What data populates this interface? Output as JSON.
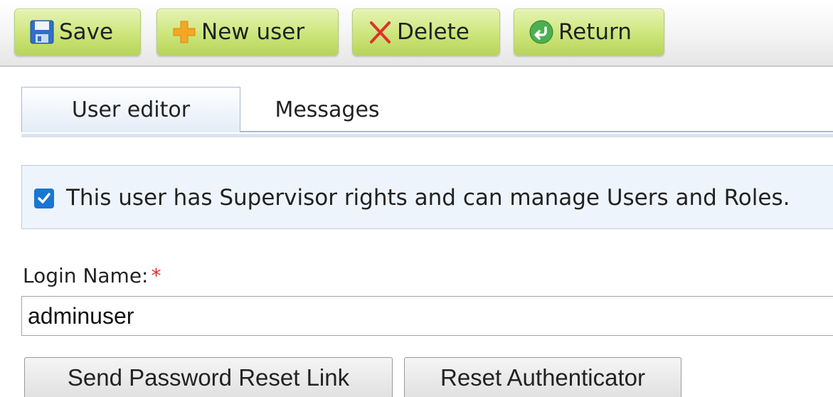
{
  "toolbar": {
    "save_label": "Save",
    "new_user_label": "New user",
    "delete_label": "Delete",
    "return_label": "Return",
    "icons": [
      "save-icon",
      "plus-icon",
      "delete-x-icon",
      "return-arrow-icon"
    ]
  },
  "tabs": [
    {
      "label": "User editor",
      "active": true
    },
    {
      "label": "Messages",
      "active": false
    }
  ],
  "supervisor": {
    "checked": true,
    "text": "This user has Supervisor rights and can manage Users and Roles."
  },
  "login": {
    "label": "Login Name:",
    "required_marker": "*",
    "value": "adminuser"
  },
  "actions": {
    "send_reset_link": "Send Password Reset Link",
    "reset_authenticator": "Reset Authenticator"
  },
  "colors": {
    "toolbar_button": "#cfe77f",
    "accent": "#1976d2",
    "required": "#e0302a"
  }
}
